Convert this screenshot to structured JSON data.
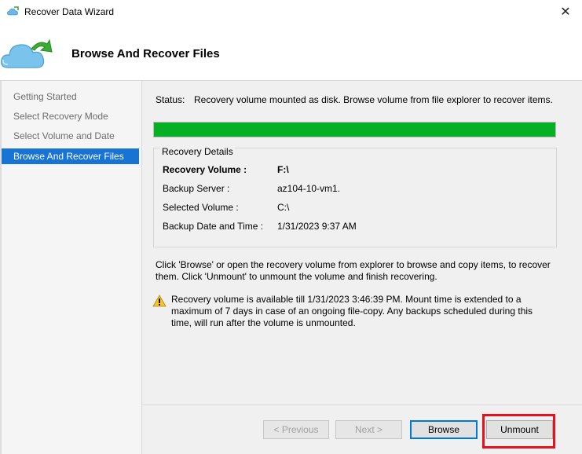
{
  "window": {
    "title": "Recover Data Wizard"
  },
  "header": {
    "title": "Browse And Recover Files"
  },
  "sidebar": {
    "items": [
      {
        "label": "Getting Started",
        "active": false
      },
      {
        "label": "Select Recovery Mode",
        "active": false
      },
      {
        "label": "Select Volume and Date",
        "active": false
      },
      {
        "label": "Browse And Recover Files",
        "active": true
      }
    ]
  },
  "status": {
    "label": "Status:",
    "text": "Recovery volume mounted as disk. Browse volume from file explorer to recover items.",
    "progress_percent": 100,
    "progress_color": "#06b025"
  },
  "details": {
    "legend": "Recovery Details",
    "rows": [
      {
        "label": "Recovery Volume :",
        "value": "F:\\"
      },
      {
        "label": "Backup Server :",
        "value": "az104-10-vm1."
      },
      {
        "label": "Selected Volume :",
        "value": "C:\\"
      },
      {
        "label": "Backup Date and Time :",
        "value": "1/31/2023 9:37 AM"
      }
    ]
  },
  "instructions": "Click 'Browse' or open the recovery volume from explorer to browse and copy items, to recover them. Click 'Unmount' to unmount the volume and finish recovering.",
  "warning": {
    "icon": "warning-icon",
    "text": "Recovery volume is available till 1/31/2023 3:46:39 PM. Mount time is extended to a maximum of 7 days in case of an ongoing file-copy. Any backups scheduled during this time, will run after the volume is unmounted."
  },
  "buttons": {
    "previous": "< Previous",
    "next": "Next >",
    "browse": "Browse",
    "unmount": "Unmount"
  },
  "colors": {
    "accent": "#1874d4",
    "highlight": "#e8101c"
  }
}
